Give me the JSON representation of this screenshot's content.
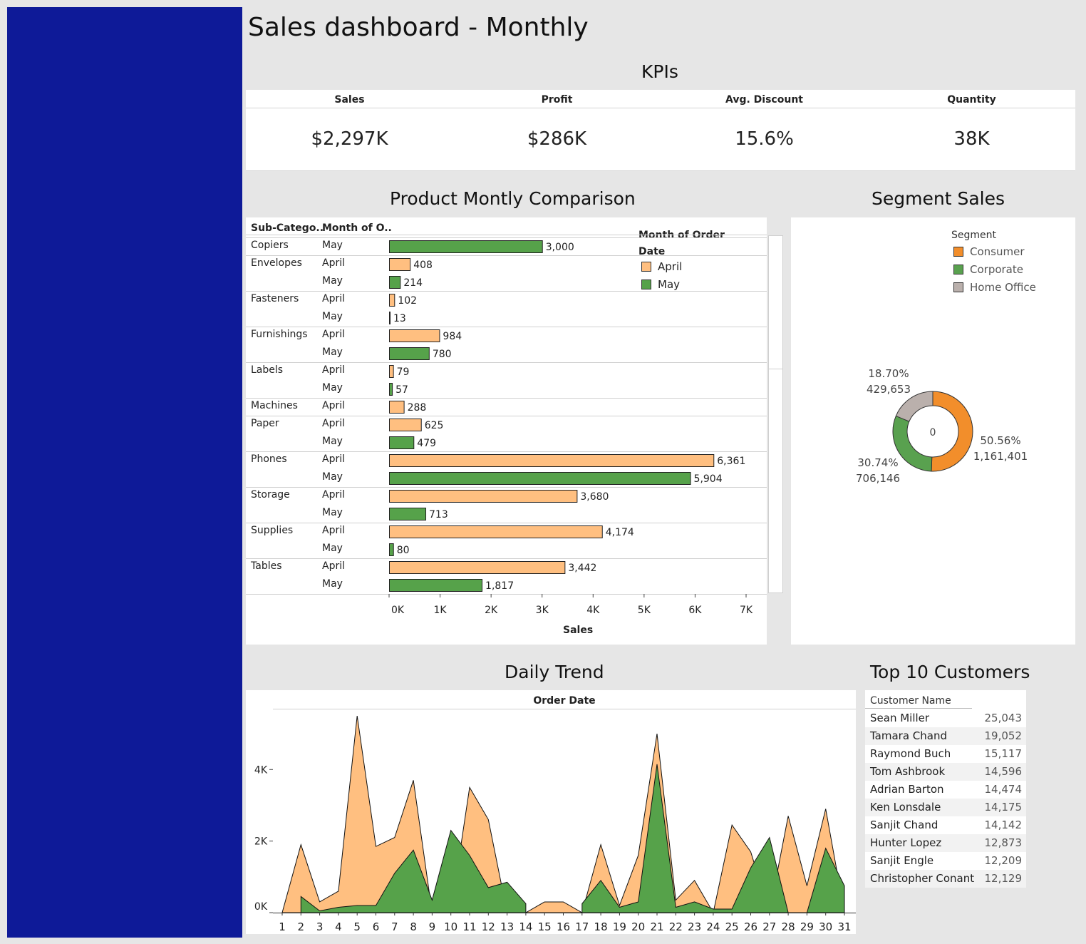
{
  "dashboard": {
    "title": "Sales dashboard - Monthly",
    "kpi_title": "KPIs",
    "product_title": "Product Montly Comparison",
    "segment_title": "Segment Sales",
    "daily_title": "Daily Trend",
    "customers_title": "Top 10 Customers"
  },
  "kpis": [
    {
      "label": "Sales",
      "value": "$2,297K"
    },
    {
      "label": "Profit",
      "value": "$286K"
    },
    {
      "label": "Avg. Discount",
      "value": "15.6%"
    },
    {
      "label": "Quantity",
      "value": "38K"
    }
  ],
  "colors": {
    "april": "#ffbf80",
    "may": "#56a24a",
    "consumer": "#f28e2b",
    "corporate": "#59a14f",
    "home_office": "#bab0ac",
    "sidebar": "#0e1a98"
  },
  "chart_data": [
    {
      "type": "bar",
      "orientation": "horizontal",
      "title": "Product Montly Comparison",
      "col_headers": [
        "Sub-Catego..",
        "Month of O.."
      ],
      "xlabel": "Sales",
      "xlim": [
        0,
        7000
      ],
      "x_ticks": [
        "0K",
        "1K",
        "2K",
        "3K",
        "4K",
        "5K",
        "6K",
        "7K"
      ],
      "legend_title": "Month of Order Date",
      "legend": [
        {
          "name": "April",
          "color": "#ffbf80"
        },
        {
          "name": "May",
          "color": "#56a24a"
        }
      ],
      "rows": [
        {
          "sub_category": "Copiers",
          "month": "May",
          "value": 3000,
          "label": "3,000"
        },
        {
          "sub_category": "Envelopes",
          "month": "April",
          "value": 408,
          "label": "408"
        },
        {
          "sub_category": "",
          "month": "May",
          "value": 214,
          "label": "214"
        },
        {
          "sub_category": "Fasteners",
          "month": "April",
          "value": 102,
          "label": "102"
        },
        {
          "sub_category": "",
          "month": "May",
          "value": 13,
          "label": "13"
        },
        {
          "sub_category": "Furnishings",
          "month": "April",
          "value": 984,
          "label": "984"
        },
        {
          "sub_category": "",
          "month": "May",
          "value": 780,
          "label": "780"
        },
        {
          "sub_category": "Labels",
          "month": "April",
          "value": 79,
          "label": "79"
        },
        {
          "sub_category": "",
          "month": "May",
          "value": 57,
          "label": "57"
        },
        {
          "sub_category": "Machines",
          "month": "April",
          "value": 288,
          "label": "288"
        },
        {
          "sub_category": "Paper",
          "month": "April",
          "value": 625,
          "label": "625"
        },
        {
          "sub_category": "",
          "month": "May",
          "value": 479,
          "label": "479"
        },
        {
          "sub_category": "Phones",
          "month": "April",
          "value": 6361,
          "label": "6,361"
        },
        {
          "sub_category": "",
          "month": "May",
          "value": 5904,
          "label": "5,904"
        },
        {
          "sub_category": "Storage",
          "month": "April",
          "value": 3680,
          "label": "3,680"
        },
        {
          "sub_category": "",
          "month": "May",
          "value": 713,
          "label": "713"
        },
        {
          "sub_category": "Supplies",
          "month": "April",
          "value": 4174,
          "label": "4,174"
        },
        {
          "sub_category": "",
          "month": "May",
          "value": 80,
          "label": "80"
        },
        {
          "sub_category": "Tables",
          "month": "April",
          "value": 3442,
          "label": "3,442"
        },
        {
          "sub_category": "",
          "month": "May",
          "value": 1817,
          "label": "1,817"
        }
      ]
    },
    {
      "type": "pie",
      "variant": "donut",
      "title": "Segment Sales",
      "legend_title": "Segment",
      "center_label": "0",
      "slices": [
        {
          "name": "Consumer",
          "value": 1161401,
          "percent": 50.56,
          "pct_label": "50.56%",
          "val_label": "1,161,401",
          "color": "#f28e2b"
        },
        {
          "name": "Corporate",
          "value": 706146,
          "percent": 30.74,
          "pct_label": "30.74%",
          "val_label": "706,146",
          "color": "#59a14f"
        },
        {
          "name": "Home Office",
          "value": 429653,
          "percent": 18.7,
          "pct_label": "18.70%",
          "val_label": "429,653",
          "color": "#bab0ac"
        }
      ]
    },
    {
      "type": "area",
      "title": "Daily Trend",
      "column_header": "Order Date",
      "x": [
        1,
        2,
        3,
        4,
        5,
        6,
        7,
        8,
        9,
        10,
        11,
        12,
        13,
        14,
        15,
        16,
        17,
        18,
        19,
        20,
        21,
        22,
        23,
        24,
        25,
        26,
        27,
        28,
        29,
        30,
        31
      ],
      "ylim": [
        0,
        5600
      ],
      "y_ticks": [
        {
          "v": 0,
          "t": "0K"
        },
        {
          "v": 2000,
          "t": "2K"
        },
        {
          "v": 4000,
          "t": "4K"
        }
      ],
      "series": [
        {
          "name": "April",
          "color": "#ffbf80",
          "values": [
            0,
            1900,
            300,
            600,
            5500,
            1850,
            2100,
            3700,
            0,
            0,
            3500,
            2600,
            0,
            0,
            300,
            300,
            0,
            1900,
            200,
            1600,
            5000,
            350,
            900,
            0,
            2450,
            1700,
            0,
            2700,
            750,
            2900,
            0
          ]
        },
        {
          "name": "May",
          "color": "#56a24a",
          "values": [
            null,
            450,
            50,
            150,
            200,
            200,
            1100,
            1750,
            350,
            2300,
            1600,
            700,
            850,
            250,
            null,
            null,
            250,
            900,
            150,
            300,
            4150,
            150,
            300,
            100,
            100,
            1250,
            2100,
            0,
            0,
            1800,
            750
          ]
        }
      ]
    }
  ],
  "customers": {
    "header": "Customer Name",
    "rows": [
      {
        "name": "Sean Miller",
        "value": "25,043"
      },
      {
        "name": "Tamara Chand",
        "value": "19,052"
      },
      {
        "name": "Raymond Buch",
        "value": "15,117"
      },
      {
        "name": "Tom Ashbrook",
        "value": "14,596"
      },
      {
        "name": "Adrian Barton",
        "value": "14,474"
      },
      {
        "name": "Ken Lonsdale",
        "value": "14,175"
      },
      {
        "name": "Sanjit Chand",
        "value": "14,142"
      },
      {
        "name": "Hunter Lopez",
        "value": "12,873"
      },
      {
        "name": "Sanjit Engle",
        "value": "12,209"
      },
      {
        "name": "Christopher Conant",
        "value": "12,129"
      }
    ]
  }
}
